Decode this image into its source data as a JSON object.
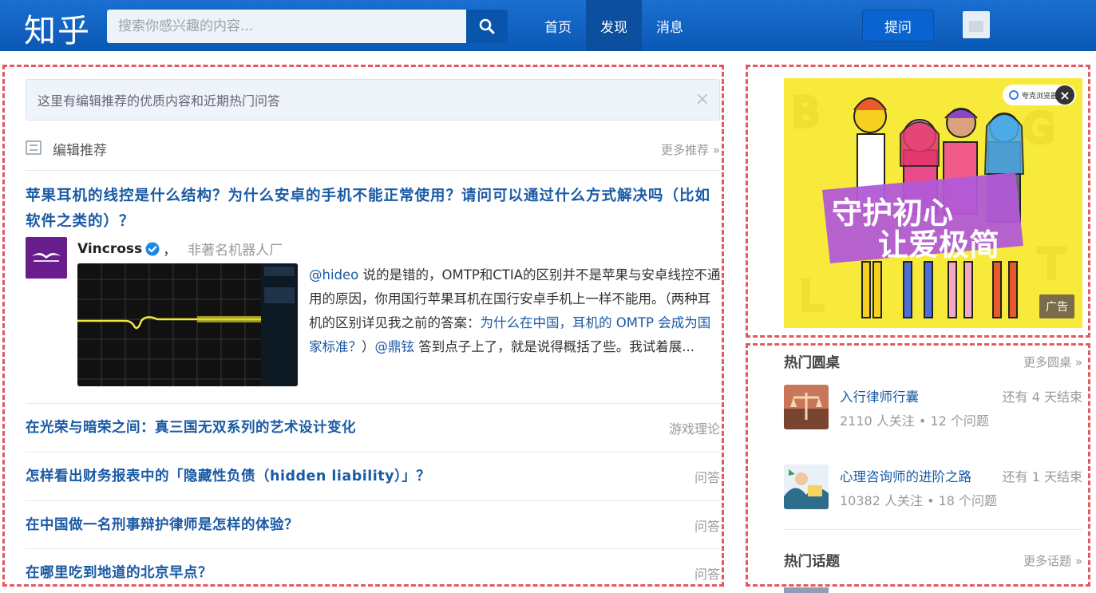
{
  "header": {
    "logo": "知乎",
    "search_placeholder": "搜索你感兴趣的内容...",
    "nav": [
      "首页",
      "发现",
      "消息"
    ],
    "active_nav": "发现",
    "ask_label": "提问"
  },
  "main": {
    "notice": "这里有编辑推荐的优质内容和近期热门问答",
    "notice_close": "×",
    "section_title": "编辑推荐",
    "section_more": "更多推荐 »",
    "featured": {
      "question": "苹果耳机的线控是什么结构？为什么安卓的手机不能正常使用？请问可以通过什么方式解决吗（比如软件之类的）？",
      "author_name": "Vincross",
      "author_sep": "，",
      "author_bio": "非著名机器人厂",
      "answer_p1": "@hideo",
      "answer_p2": " 说的是错的，OMTP和CTIA的区别并不是苹果与安卓线控不通用的原因，你用国行苹果耳机在国行安卓手机上一样不能用。（两种耳机的区别详见我之前的答案：",
      "answer_link": "为什么在中国，耳机的 OMTP 会成为国家标准？",
      "answer_p3": "）",
      "answer_mention": "@鼎铉",
      "answer_p4": " 答到点子上了，就是说得概括了些。我试着展..."
    },
    "questions": [
      {
        "title": "在光荣与暗荣之间：真三国无双系列的艺术设计变化",
        "tag": "游戏理论"
      },
      {
        "title": "怎样看出财务报表中的「隐藏性负债（hidden liability）」？",
        "tag": "问答"
      },
      {
        "title": "在中国做一名刑事辩护律师是怎样的体验？",
        "tag": "问答"
      },
      {
        "title": "在哪里吃到地道的北京早点？",
        "tag": "问答"
      }
    ]
  },
  "ad": {
    "line1": "守护初心",
    "line2": "让爱极简",
    "label": "广告",
    "brand": "夸克浏览器"
  },
  "sidebar": {
    "roundtable_title": "热门圆桌",
    "roundtable_more": "更多圆桌 »",
    "roundtables": [
      {
        "name": "入行律师行囊",
        "remain": "还有 4 天结束",
        "meta": "2110 人关注 • 12 个问题"
      },
      {
        "name": "心理咨询师的进阶之路",
        "remain": "还有 1 天结束",
        "meta": "10382 人关注 • 18 个问题"
      }
    ],
    "topics_title": "热门话题",
    "topics_more": "更多话题 »"
  },
  "colors": {
    "brand_blue": "#0b58b5",
    "link_blue": "#1a5aa5",
    "ad_yellow": "#f7ea3a",
    "dashed_frame": "#e4585e"
  }
}
